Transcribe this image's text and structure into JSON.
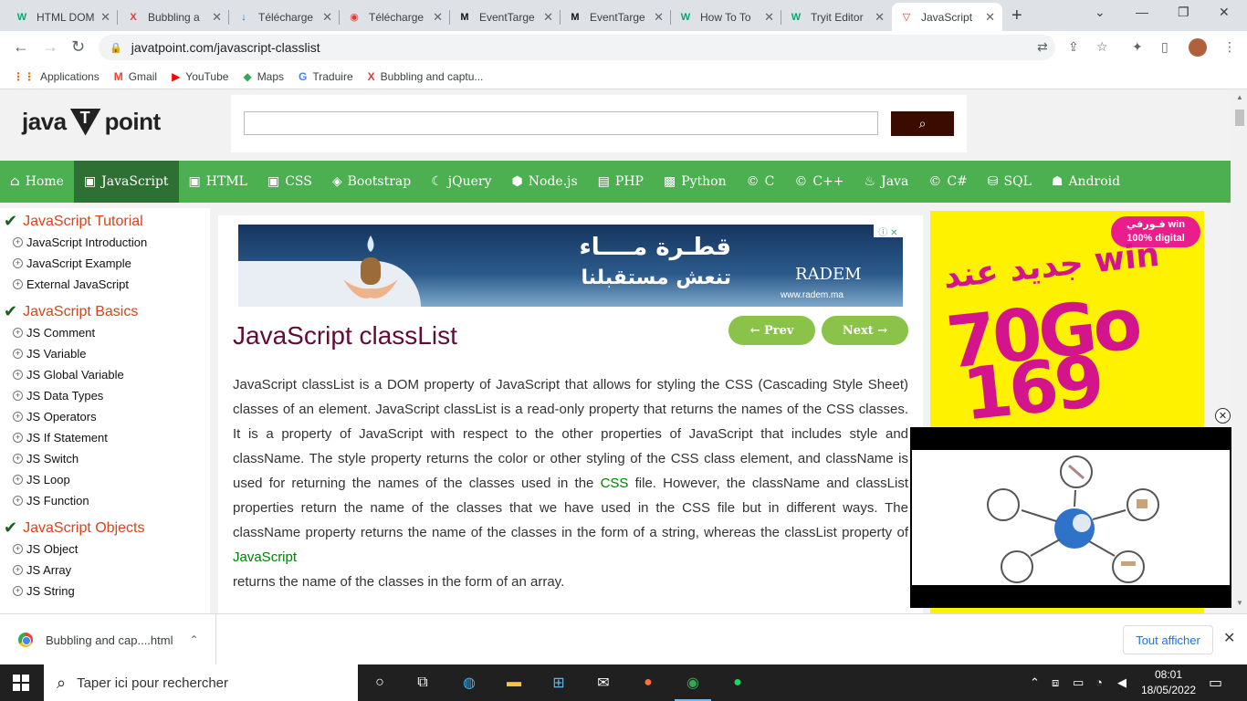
{
  "browser": {
    "tabs": [
      {
        "title": "HTML DOM",
        "icon": "W",
        "color": "#04aa6d"
      },
      {
        "title": "Bubbling a",
        "icon": "X",
        "color": "#e53935"
      },
      {
        "title": "Télécharge",
        "icon": "↓",
        "color": "#1a73e8"
      },
      {
        "title": "Télécharge",
        "icon": "◉",
        "color": "#e53935"
      },
      {
        "title": "EventTarge",
        "icon": "M",
        "color": "#111111"
      },
      {
        "title": "EventTarge",
        "icon": "M",
        "color": "#111111"
      },
      {
        "title": "How To To",
        "icon": "W",
        "color": "#04aa6d"
      },
      {
        "title": "Tryit Editor",
        "icon": "W",
        "color": "#04aa6d"
      },
      {
        "title": "JavaScript",
        "icon": "▽",
        "color": "#e53935"
      }
    ],
    "url": "javatpoint.com/javascript-classlist",
    "bookmarks": [
      {
        "label": "Applications",
        "icon": "⋮⋮",
        "color": "#e8710a"
      },
      {
        "label": "Gmail",
        "icon": "M",
        "color": "#ea4335"
      },
      {
        "label": "YouTube",
        "icon": "▶",
        "color": "#ff0000"
      },
      {
        "label": "Maps",
        "icon": "◆",
        "color": "#34a853"
      },
      {
        "label": "Traduire",
        "icon": "G",
        "color": "#4285f4"
      },
      {
        "label": "Bubbling and captu...",
        "icon": "X",
        "color": "#e53935"
      }
    ]
  },
  "site": {
    "logo_left": "java",
    "logo_mid": "T",
    "logo_right": "point",
    "nav": [
      {
        "label": "Home",
        "icon": "⌂"
      },
      {
        "label": "JavaScript",
        "icon": "▣"
      },
      {
        "label": "HTML",
        "icon": "▣"
      },
      {
        "label": "CSS",
        "icon": "▣"
      },
      {
        "label": "Bootstrap",
        "icon": "◈"
      },
      {
        "label": "jQuery",
        "icon": "☾"
      },
      {
        "label": "Node.js",
        "icon": "⬢"
      },
      {
        "label": "PHP",
        "icon": "▤"
      },
      {
        "label": "Python",
        "icon": "▩"
      },
      {
        "label": "C",
        "icon": "©"
      },
      {
        "label": "C++",
        "icon": "©"
      },
      {
        "label": "Java",
        "icon": "♨"
      },
      {
        "label": "C#",
        "icon": "©"
      },
      {
        "label": "SQL",
        "icon": "⛁"
      },
      {
        "label": "Android",
        "icon": "☗"
      }
    ],
    "active_nav": "JavaScript",
    "accent": "#4caf50"
  },
  "sidebar": {
    "sections": [
      {
        "heading": "JavaScript Tutorial",
        "items": [
          "JavaScript Introduction",
          "JavaScript Example",
          "External JavaScript"
        ]
      },
      {
        "heading": "JavaScript Basics",
        "items": [
          "JS Comment",
          "JS Variable",
          "JS Global Variable",
          "JS Data Types",
          "JS Operators",
          "JS If Statement",
          "JS Switch",
          "JS Loop",
          "JS Function"
        ]
      },
      {
        "heading": "JavaScript Objects",
        "items": [
          "JS Object",
          "JS Array",
          "JS String"
        ]
      }
    ]
  },
  "ad_banner": {
    "arabic_line1": "قطـرة مــــاء",
    "arabic_line2": "تنعش مستقبلنا",
    "brand": "RADEM",
    "url": "www.radem.ma"
  },
  "article": {
    "title": "JavaScript classList",
    "prev_label": "← Prev",
    "next_label": "Next →",
    "para_part1": "JavaScript classList is a DOM property of JavaScript that allows for styling the CSS (Cascading Style Sheet) classes of an element. JavaScript classList is a read-only property that returns the names of the CSS classes. It is a property of JavaScript with respect to the other properties of JavaScript that includes style and className. The style property returns the color or other styling of the CSS class element, and className is used for returning the names of the classes used in the ",
    "link_css": "CSS",
    "para_part2": "file. However, the className and classList properties return the name of the classes that we have used in the CSS file but in different ways. The className property returns the name of the classes in the form of a string, whereas the classList property of ",
    "link_js": "JavaScript",
    "para_part3": "returns the name of the classes in the form of an array."
  },
  "side_ad": {
    "badge_line1": "فـورفي win",
    "badge_line2": "100% digital",
    "line1": "جديد عند win",
    "line2": "70Go",
    "line3": "169"
  },
  "downloads": {
    "file": "Bubbling and cap....html",
    "show_all": "Tout afficher"
  },
  "taskbar": {
    "search_placeholder": "Taper ici pour rechercher",
    "time": "08:01",
    "date": "18/05/2022"
  }
}
